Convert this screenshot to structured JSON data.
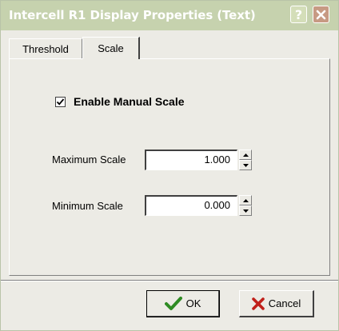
{
  "window": {
    "title": "Intercell R1 Display Properties (Text)",
    "help_glyph": "?"
  },
  "tabs": [
    {
      "label": "Threshold",
      "active": false
    },
    {
      "label": "Scale",
      "active": true
    }
  ],
  "scale": {
    "enable_manual_scale": {
      "label": "Enable Manual Scale",
      "checked": true
    },
    "maximum": {
      "label": "Maximum Scale",
      "value": "1.000"
    },
    "minimum": {
      "label": "Minimum Scale",
      "value": "0.000"
    }
  },
  "buttons": {
    "ok_label": "OK",
    "cancel_label": "Cancel"
  },
  "colors": {
    "titlebar": "#c6d2ae",
    "dialog_bg": "#ecebe5",
    "ok_icon": "#2e8b23",
    "cancel_icon": "#c0201a"
  },
  "icons": {
    "help": "help-icon",
    "close": "close-icon",
    "checkmark": "checkmark-icon",
    "spin_up": "spin-up-arrow-icon",
    "spin_down": "spin-down-arrow-icon",
    "ok": "green-check-icon",
    "cancel": "red-x-icon"
  }
}
